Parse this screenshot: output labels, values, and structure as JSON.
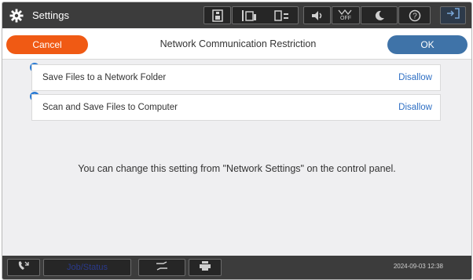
{
  "header": {
    "app_title": "Settings",
    "app_icon": "gear-icon",
    "status_icons": [
      "ink-level-icon",
      "paper-icon",
      "network-icon",
      "sound-icon",
      "wifi-off-icon",
      "sleep-icon",
      "help-icon"
    ],
    "wifi_label": "OFF"
  },
  "dialog": {
    "title": "Network Communication Restriction",
    "cancel_label": "Cancel",
    "ok_label": "OK",
    "colors": {
      "cancel": "#f05a14",
      "ok": "#3f73a8",
      "link": "#2e6fc4"
    }
  },
  "items": [
    {
      "label": "Save Files to a Network Folder",
      "value": "Disallow"
    },
    {
      "label": "Scan and Save Files to Computer",
      "value": "Disallow"
    }
  ],
  "message": "You can change this setting from \"Network Settings\" on the control panel.",
  "footer": {
    "job_status_label": "Job/Status",
    "datetime": "2024-09-03 12:38"
  }
}
